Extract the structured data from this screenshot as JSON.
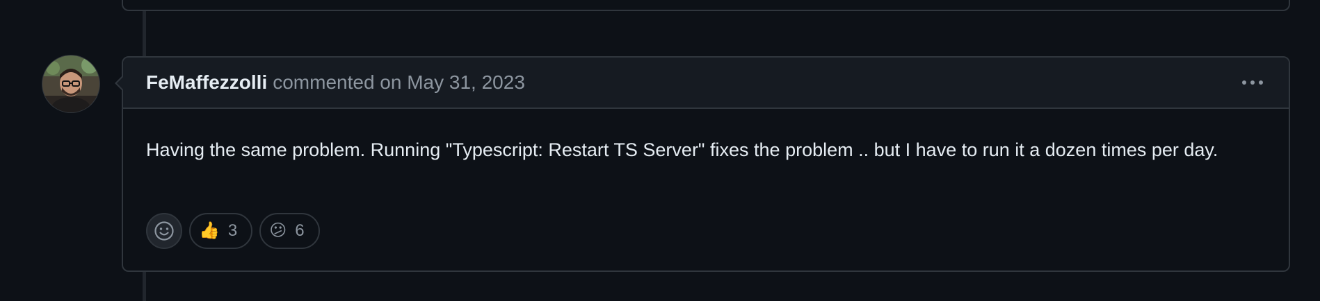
{
  "comment": {
    "author": "FeMaffezzolli",
    "meta": "commented on May 31, 2023",
    "body": "Having the same problem. Running \"Typescript: Restart TS Server\" fixes the problem .. but I have to run it a dozen times per day."
  },
  "reactions": [
    {
      "emoji": "👍",
      "count": "3",
      "icon": "thumbs-up-icon"
    },
    {
      "emoji": "😕",
      "count": "6",
      "icon": "confused-face-icon"
    }
  ],
  "colors": {
    "background": "#0d1117",
    "header": "#161b22",
    "border": "#30363d",
    "muted_text": "#8d96a0",
    "text": "#e6edf3"
  }
}
